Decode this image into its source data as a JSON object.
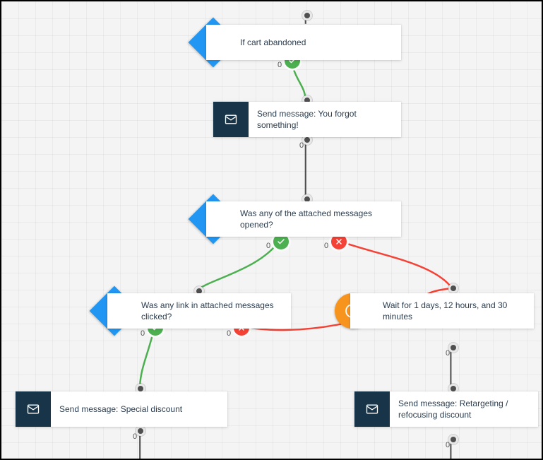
{
  "nodes": {
    "n1": {
      "type": "condition",
      "label": "If cart abandoned",
      "icon": "cart"
    },
    "n2": {
      "type": "action",
      "label": "Send message: You forgot something!",
      "icon": "mail"
    },
    "n3": {
      "type": "condition",
      "label": "Was any of the attached messages opened?",
      "icon": "mail-open"
    },
    "n4": {
      "type": "condition",
      "label": "Was any link in attached messages clicked?",
      "icon": "click"
    },
    "n5": {
      "type": "wait",
      "label": "Wait for 1 days, 12 hours, and 30 minutes",
      "icon": "clock"
    },
    "n6": {
      "type": "action",
      "label": "Send message: Special discount",
      "icon": "mail"
    },
    "n7": {
      "type": "action",
      "label": "Send message: Retargeting / refocusing discount",
      "icon": "mail"
    }
  },
  "edge_labels": {
    "e_n1_yes": "0",
    "e_n2_out": "0",
    "e_n3_yes": "0",
    "e_n3_no": "0",
    "e_n4_yes": "0",
    "e_n4_no": "0",
    "e_n5_out": "0",
    "e_n6_out": "0",
    "e_n7_out": "0"
  },
  "colors": {
    "condition_blue": "#2196f3",
    "action_dark": "#183448",
    "wait_orange": "#f7941e",
    "yes": "#4caf50",
    "no": "#f44336",
    "connector_default": "#4a4a4a"
  }
}
